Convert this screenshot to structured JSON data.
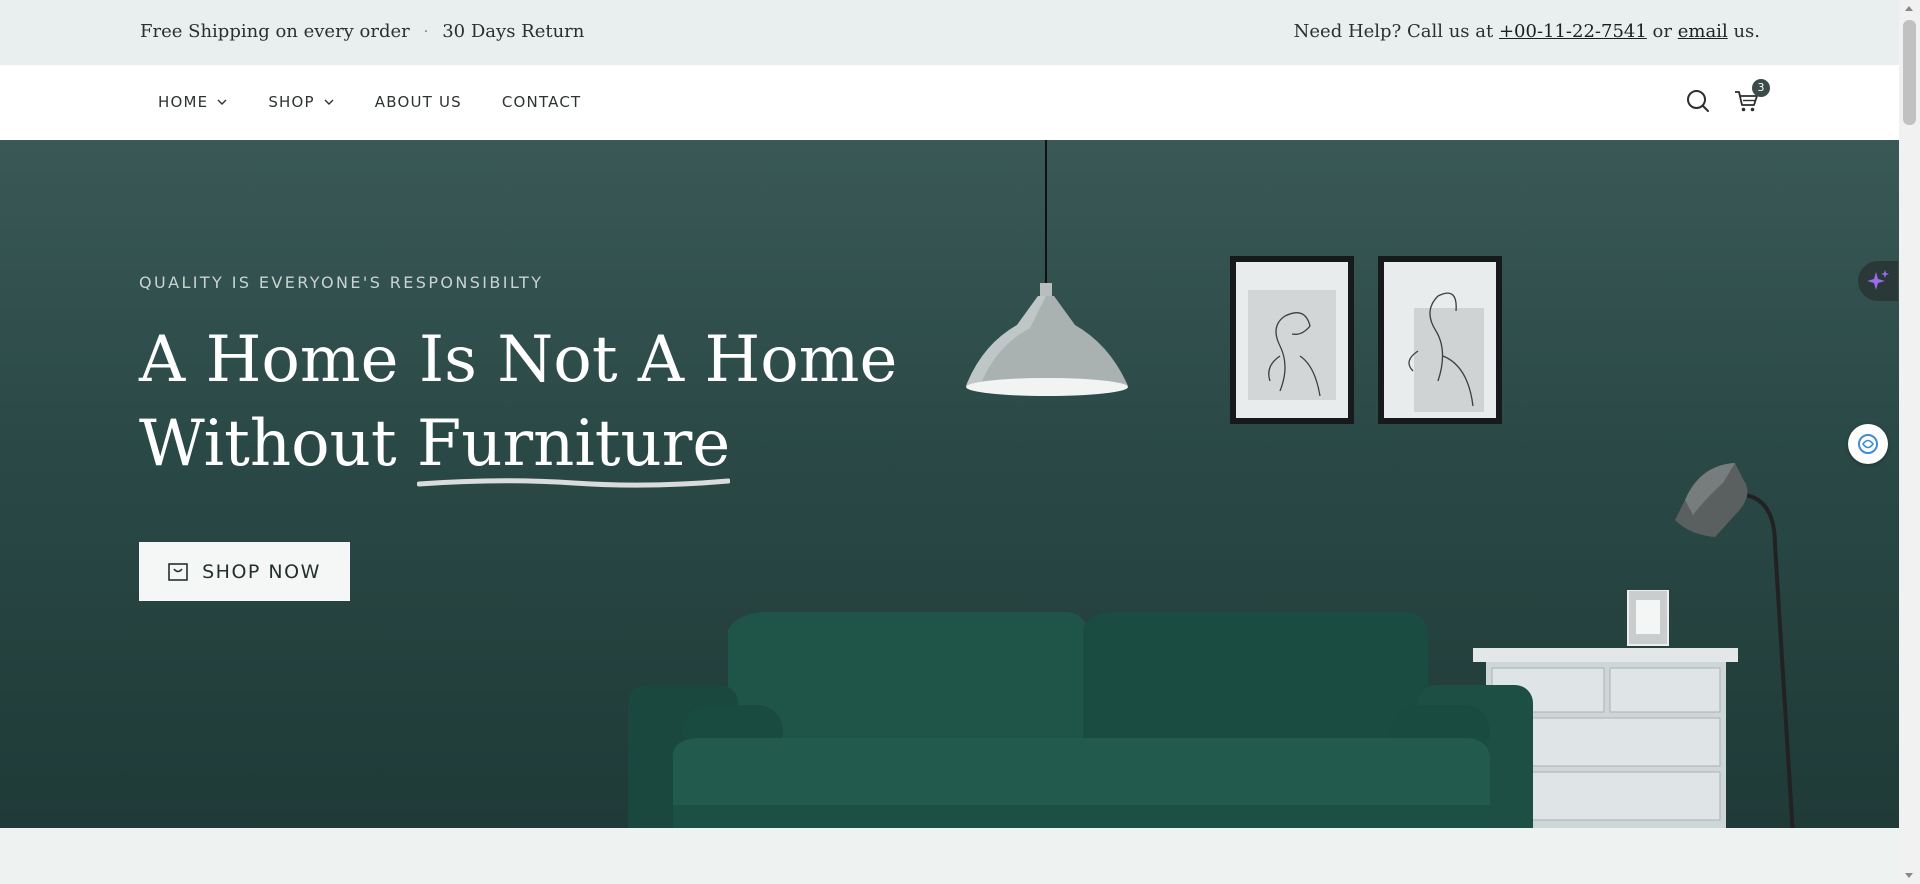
{
  "topbar": {
    "shipping": "Free Shipping on every order",
    "separator": "·",
    "returns": "30 Days Return",
    "help_prefix": "Need Help? Call us at",
    "phone": "+00-11-22-7541",
    "or": "or",
    "email": "email",
    "suffix": "us."
  },
  "nav": {
    "items": [
      {
        "label": "HOME",
        "dropdown": true
      },
      {
        "label": "SHOP",
        "dropdown": true
      },
      {
        "label": "ABOUT US",
        "dropdown": false
      },
      {
        "label": "CONTACT",
        "dropdown": false
      }
    ],
    "cart_count": "3"
  },
  "hero": {
    "tagline": "QUALITY IS EVERYONE'S RESPONSIBILTY",
    "headline_line1": "A Home Is Not A Home",
    "headline_line2_prefix": "Without",
    "headline_line2_highlight": "Furniture",
    "cta_label": "SHOP NOW"
  },
  "colors": {
    "hero_bg": "#2a4946",
    "topbar_bg": "#e9efee",
    "sofa": "#1f5247",
    "accent_ai": "#9b6cf0"
  }
}
